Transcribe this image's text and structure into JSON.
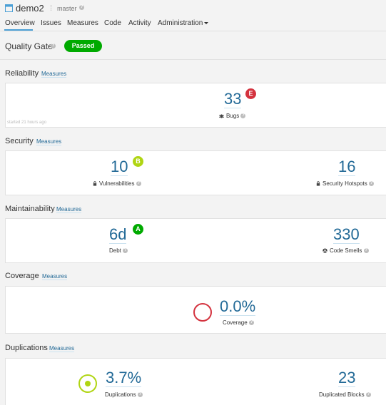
{
  "header": {
    "project_name": "demo2",
    "branch_separator": "⁞",
    "branch": "master",
    "nav": {
      "overview": "Overview",
      "issues": "Issues",
      "measures": "Measures",
      "code": "Code",
      "activity": "Activity",
      "administration": "Administration"
    }
  },
  "quality_gate": {
    "label": "Quality Gate",
    "status": "Passed",
    "status_color": "#00aa00"
  },
  "info_glyph": "?",
  "reliability": {
    "title": "Reliability",
    "link": "Measures",
    "bugs_value": "33",
    "bugs_rating": "E",
    "bugs_label": "Bugs",
    "started": "started 21 hours ago"
  },
  "security": {
    "title": "Security",
    "link": "Measures",
    "vulnerabilities_value": "10",
    "vulnerabilities_rating": "B",
    "vulnerabilities_label": "Vulnerabilities",
    "hotspots_value": "16",
    "hotspots_label": "Security Hotspots"
  },
  "maintainability": {
    "title": "Maintainability",
    "link": "Measures",
    "debt_value": "6d",
    "debt_rating": "A",
    "debt_label": "Debt",
    "smells_value": "330",
    "smells_label": "Code Smells"
  },
  "coverage": {
    "title": "Coverage",
    "link": "Measures",
    "value": "0.0%",
    "label": "Coverage"
  },
  "duplications": {
    "title": "Duplications",
    "link": "Measures",
    "value": "3.7%",
    "label": "Duplications",
    "blocks_value": "23",
    "blocks_label": "Duplicated Blocks"
  },
  "colors": {
    "link": "#236a97",
    "rating_e": "#d4333f",
    "rating_b": "#b0d513",
    "rating_a": "#00aa00"
  }
}
